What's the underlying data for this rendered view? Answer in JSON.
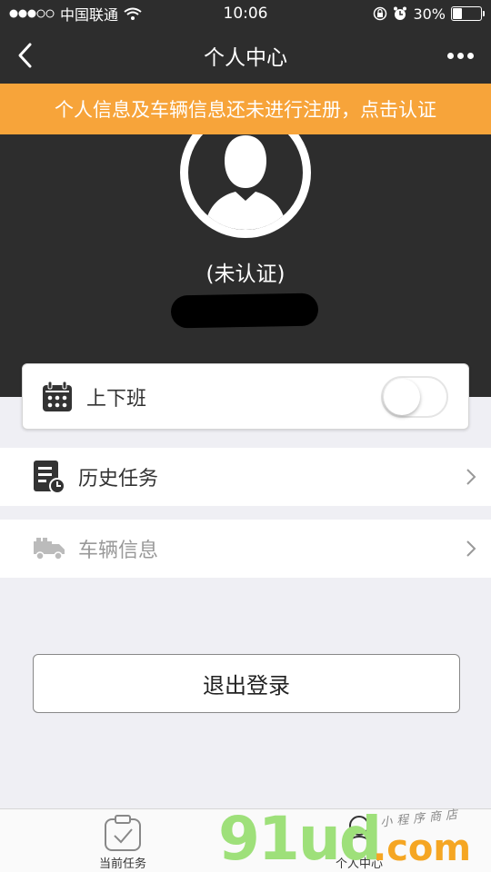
{
  "status_bar": {
    "carrier": "中国联通",
    "time": "10:06",
    "battery": "30%",
    "battery_level": 0.3
  },
  "nav": {
    "title": "个人中心"
  },
  "notice": {
    "text": "个人信息及车辆信息还未进行注册，点击认证",
    "color": "#f7a43a"
  },
  "profile": {
    "status": "(未认证)"
  },
  "shift_toggle": {
    "label": "上下班",
    "on": false
  },
  "menu": {
    "history": "历史任务",
    "vehicle": "车辆信息"
  },
  "logout": {
    "label": "退出登录"
  },
  "tabs": [
    {
      "label": "当前任务",
      "icon": "clipboard-check-icon"
    },
    {
      "label": "个人中心",
      "icon": "person-icon"
    }
  ],
  "watermark": {
    "brand_a": "91ud",
    "brand_b": ".com",
    "script": "小程序商店"
  },
  "colors": {
    "header": "#2d2d2d",
    "background": "#efeff4",
    "accent": "#f7a43a"
  }
}
